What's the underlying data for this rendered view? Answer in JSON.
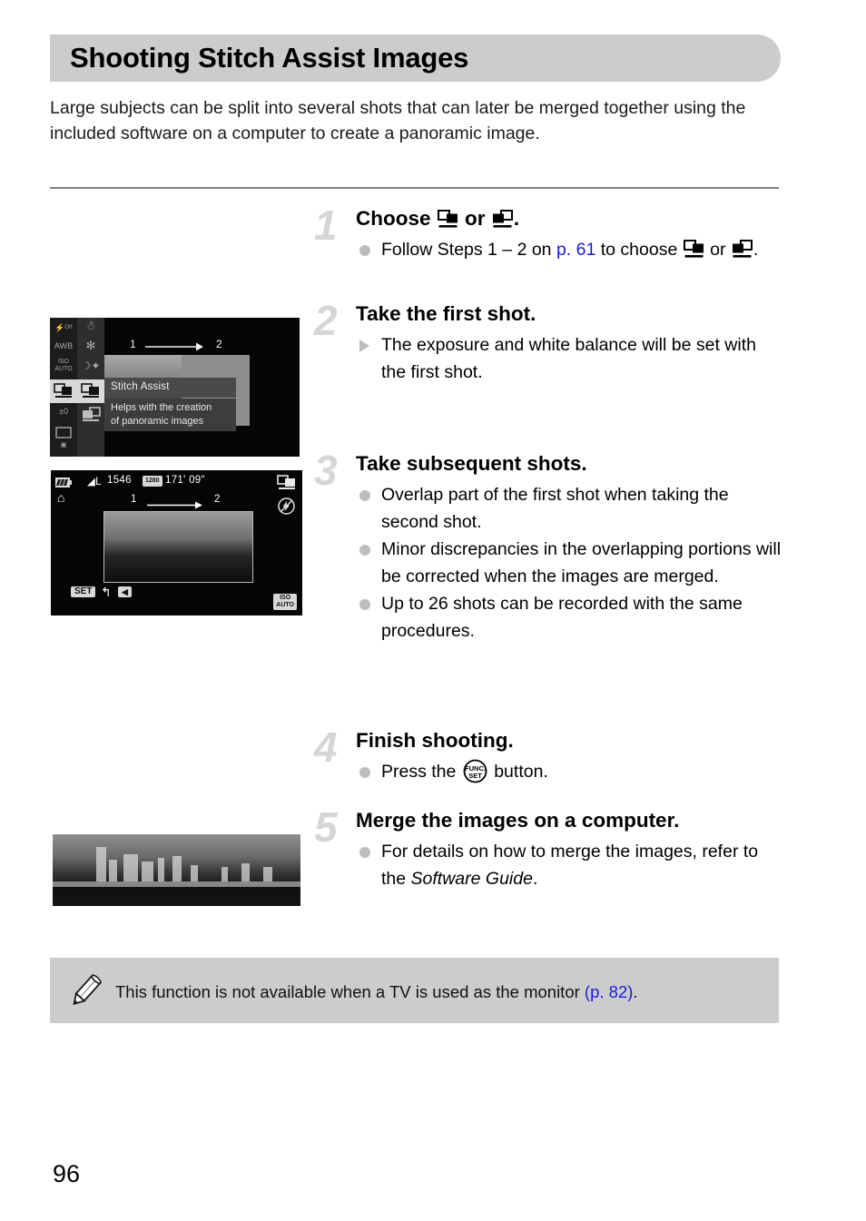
{
  "header": {
    "title": "Shooting Stitch Assist Images"
  },
  "intro": {
    "text": "Large subjects can be split into several shots that can later be merged together using the included software on a computer to create a panoramic image."
  },
  "steps": [
    {
      "number": "1",
      "title_prefix": "Choose ",
      "title_middle": " or ",
      "title_suffix": ".",
      "icon_a": "stitch-assist-right-icon",
      "icon_b": "stitch-assist-left-icon",
      "bullets": [
        {
          "marker": "dot",
          "parts": [
            {
              "text": "Follow Steps 1 – 2 on "
            },
            {
              "text": "p. 61",
              "link": true
            },
            {
              "text": " to choose "
            },
            {
              "icon": "stitch-assist-right-icon"
            },
            {
              "text": " or "
            },
            {
              "icon": "stitch-assist-left-icon"
            },
            {
              "text": "."
            }
          ]
        }
      ]
    },
    {
      "number": "2",
      "title": "Take the first shot.",
      "bullets": [
        {
          "marker": "triangle",
          "parts": [
            {
              "text": "The exposure and white balance will be set with the first shot."
            }
          ]
        }
      ]
    },
    {
      "number": "3",
      "title": "Take subsequent shots.",
      "bullets": [
        {
          "marker": "dot",
          "parts": [
            {
              "text": "Overlap part of the first shot when taking the second shot."
            }
          ]
        },
        {
          "marker": "dot",
          "parts": [
            {
              "text": "Minor discrepancies in the overlapping portions will be corrected when the images are merged."
            }
          ]
        },
        {
          "marker": "dot",
          "parts": [
            {
              "text": "Up to 26 shots can be recorded with the same procedures."
            }
          ]
        }
      ]
    },
    {
      "number": "4",
      "title": "Finish shooting.",
      "bullets": [
        {
          "marker": "dot",
          "parts": [
            {
              "text": "Press the "
            },
            {
              "icon": "func-set-button-icon"
            },
            {
              "text": " button."
            }
          ]
        }
      ]
    },
    {
      "number": "5",
      "title": "Merge the images on a computer.",
      "bullets": [
        {
          "marker": "dot",
          "parts": [
            {
              "text": "For details on how to merge the images, refer to the "
            },
            {
              "text": "Software Guide",
              "italic": true
            },
            {
              "text": "."
            }
          ]
        }
      ]
    }
  ],
  "step_titles": {
    "s1_choose": "Choose",
    "s1_or": "or",
    "s1_period": ".",
    "s2": "Take the first shot.",
    "s3": "Take subsequent shots.",
    "s4": "Finish shooting.",
    "s5": "Merge the images on a computer."
  },
  "step_numbers": {
    "n1": "1",
    "n2": "2",
    "n3": "3",
    "n4": "4",
    "n5": "5"
  },
  "bullet_text": {
    "b1_a": "Follow Steps 1 – 2 on ",
    "b1_link": "p. 61",
    "b1_b": " to choose ",
    "b1_or": " or ",
    "b1_end": ".",
    "b2": "The exposure and white balance will be set with the first shot.",
    "b3_1": "Overlap part of the first shot when taking the second shot.",
    "b3_2": "Minor discrepancies in the overlapping portions will be corrected when the images are merged.",
    "b3_3": "Up to 26 shots can be recorded with the same procedures.",
    "b4_a": "Press the ",
    "b4_b": " button.",
    "b5_a": "For details on how to merge the images, refer to the ",
    "b5_italic": "Software Guide",
    "b5_end": "."
  },
  "camera_menu_screen": {
    "panel_title": "Stitch Assist",
    "panel_desc_line1": "Helps with the creation",
    "panel_desc_line2": "of panoramic images",
    "seq_left": "1",
    "seq_right": "2",
    "left_column_icons": [
      "flash-off-icon",
      "awb-icon",
      "iso-auto-icon",
      "stitch-assist-icon",
      "exposure-compensation-icon",
      "aspect-ratio-icon",
      "image-quality-icon"
    ],
    "left_column_labels": [
      "⚡OFF",
      "AWB",
      "ISO\nAUTO",
      "",
      "±0",
      "",
      ""
    ],
    "right_column_icons": [
      "snow-scene-icon",
      "fireworks-icon",
      "night-scene-icon",
      "stitch-assist-right-icon",
      "stitch-assist-left-icon"
    ]
  },
  "camera_live_screen": {
    "battery": "battery-full-icon",
    "shutter": "shutter-icon",
    "quality": "L",
    "shots_remaining": "1546",
    "movie_icon": "movie-quality-icon",
    "time_remaining": "171' 09\"",
    "seq_left": "1",
    "seq_right": "2",
    "set_label": "SET",
    "return_icon": "return-arrow-icon",
    "direction_icon": "left-arrow-icon",
    "mode_icon": "stitch-assist-right-icon",
    "flash_icon": "flash-off-icon",
    "iso_label_top": "ISO",
    "iso_label_bottom": "AUTO"
  },
  "panorama_photo": {
    "alt": "panoramic-cityscape-photo"
  },
  "note": {
    "icon": "pencil-icon",
    "text_a": "This function is not available when a TV is used as the monitor ",
    "link": "(p. 82)",
    "text_b": "."
  },
  "footer": {
    "page_number": "96"
  },
  "colors": {
    "header_bg": "#cccccc",
    "note_bg": "#cccccc",
    "link": "#1a1ae0",
    "step_number": "#d6d6d6",
    "bullet": "#bdbdbd",
    "divider": "#808080"
  }
}
